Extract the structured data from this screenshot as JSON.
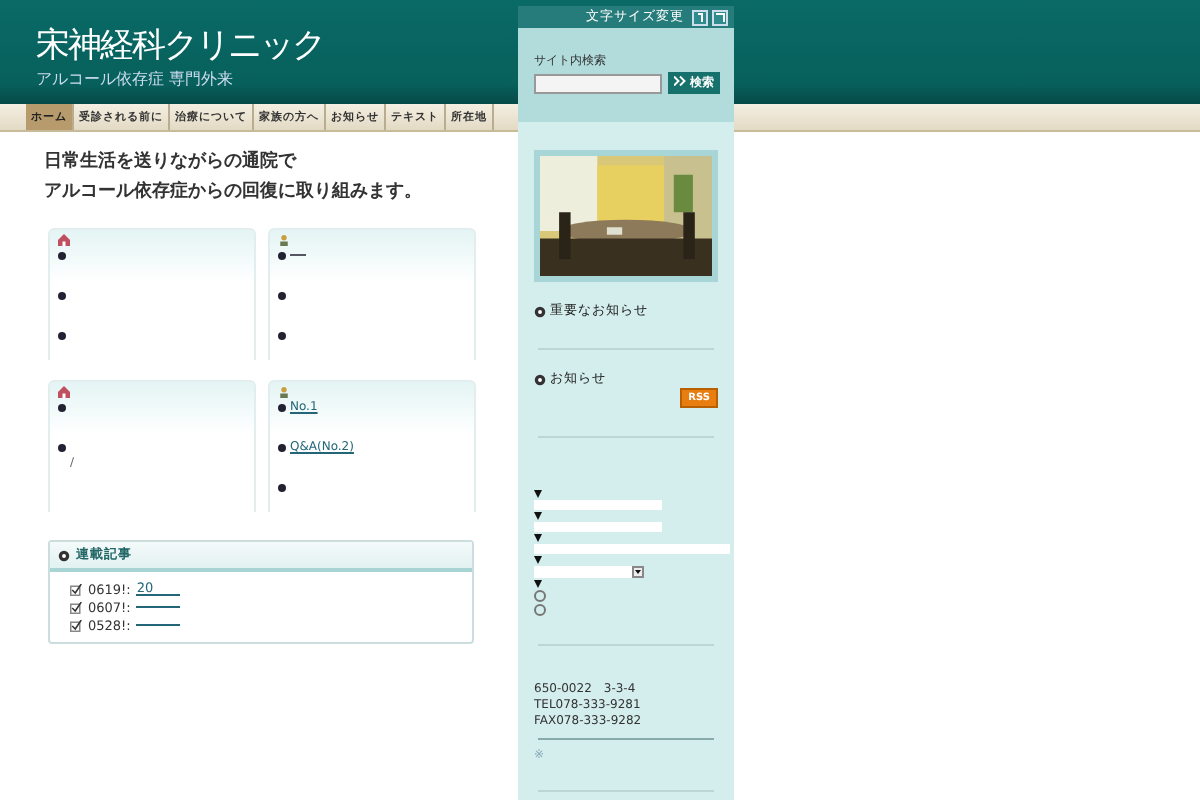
{
  "header": {
    "logo": "宋神経科クリニック",
    "tagline": "アルコール依存症 専門外来"
  },
  "font_size": {
    "label": "文字サイズ変更"
  },
  "search": {
    "label": "サイト内検索",
    "button": "検索"
  },
  "nav": [
    {
      "label": "ホーム",
      "selected": true
    },
    {
      "label": "受診される前に",
      "selected": false
    },
    {
      "label": "治療について",
      "selected": false
    },
    {
      "label": "家族の方へ",
      "selected": false
    },
    {
      "label": "お知らせ",
      "selected": false
    },
    {
      "label": "テキスト",
      "selected": false
    },
    {
      "label": "所在地",
      "selected": false
    }
  ],
  "headline": [
    "日常生活を送りながらの通院で",
    "アルコール依存症からの回復に取り組みます。"
  ],
  "cards": [
    {
      "items": [
        {
          "link": false
        },
        {
          "link": false
        },
        {
          "link": false
        }
      ]
    },
    {
      "items": [
        {
          "link": true
        },
        {
          "link": false
        },
        {
          "link": false
        }
      ]
    },
    {
      "items": [
        {
          "link": false
        },
        {
          "link": false,
          "note": "/"
        }
      ]
    },
    {
      "items": [
        {
          "text": "No.1",
          "link": true
        },
        {
          "text": "Q&A(No.2)",
          "link": true
        },
        {
          "link": false
        }
      ]
    }
  ],
  "series": {
    "title": "連載記事",
    "rows": [
      {
        "date": "0619!:",
        "link": "20"
      },
      {
        "date": "0607!:",
        "link": ""
      },
      {
        "date": "0528!:",
        "link": ""
      }
    ]
  },
  "sidebar": {
    "important": "重要なお知らせ",
    "news": "お知らせ",
    "feed_button": "RSS",
    "form": [
      {
        "kind": "text"
      },
      {
        "kind": "text"
      },
      {
        "kind": "wide"
      },
      {
        "kind": "select"
      },
      {
        "kind": "radio",
        "radios": [
          {
            "checked": false
          },
          {
            "checked": false
          }
        ]
      }
    ],
    "address": [
      "650-0022　3-3-4",
      "TEL078-333-9281",
      "FAX078-333-9282"
    ],
    "footnote": "※"
  }
}
